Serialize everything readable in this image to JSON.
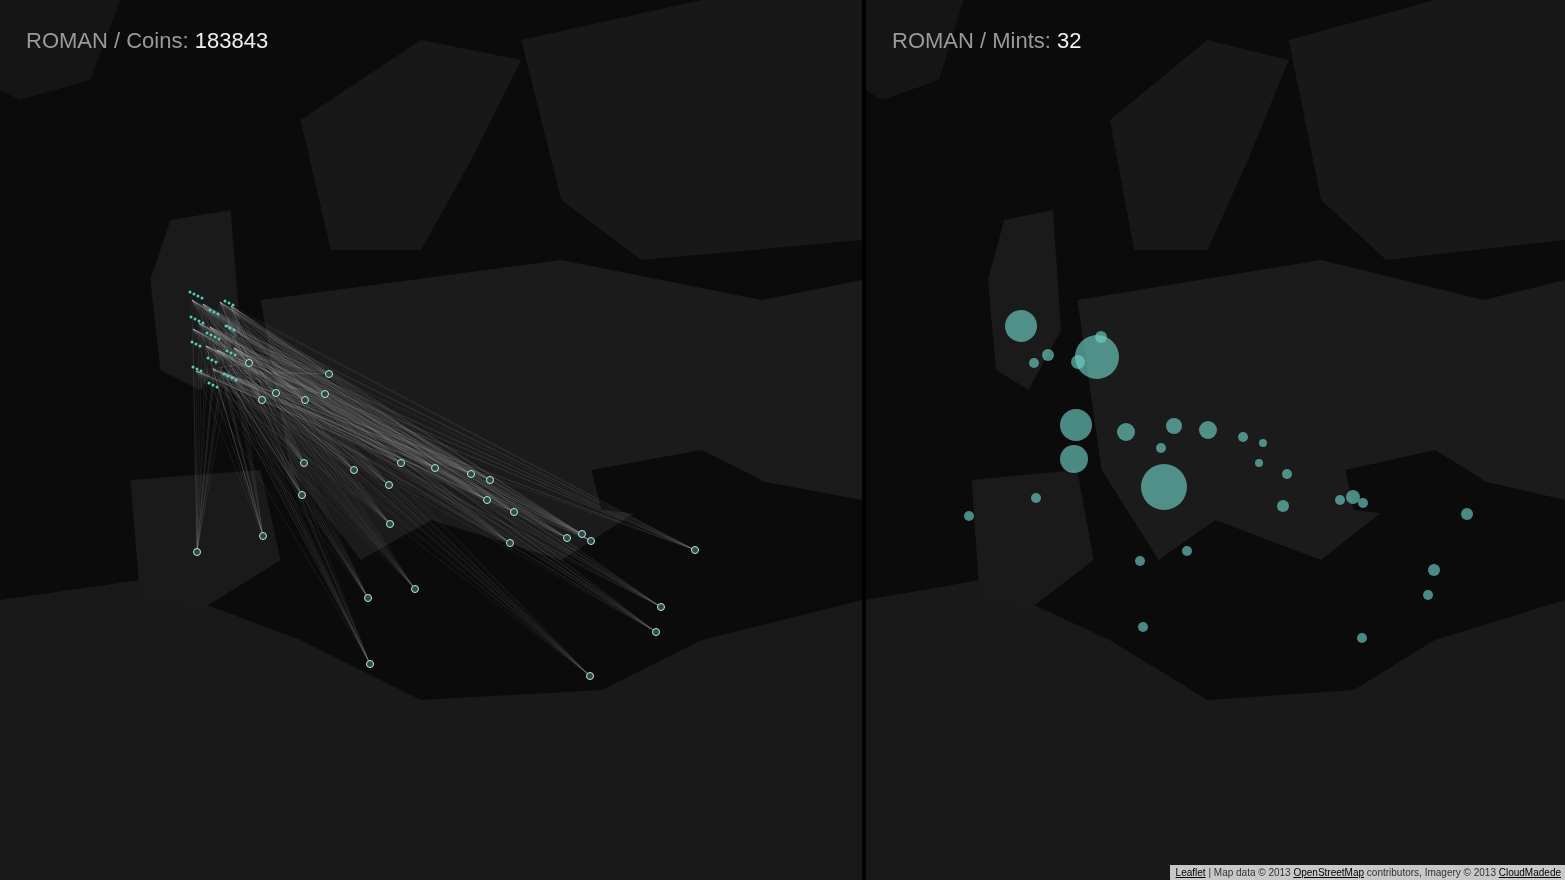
{
  "panels": [
    {
      "kind": "coins",
      "label": "ROMAN / Coins:",
      "count": "183843"
    },
    {
      "kind": "mints",
      "label": "ROMAN / Mints:",
      "count": "32"
    }
  ],
  "attribution": [
    {
      "kind": "link",
      "text": "Leaflet"
    },
    {
      "kind": "text",
      "text": "| Map data © 2013"
    },
    {
      "kind": "link",
      "text": "OpenStreetMap"
    },
    {
      "kind": "text",
      "text": "contributors, Imagery © 2013"
    },
    {
      "kind": "link",
      "text": "CloudMadede"
    }
  ]
}
